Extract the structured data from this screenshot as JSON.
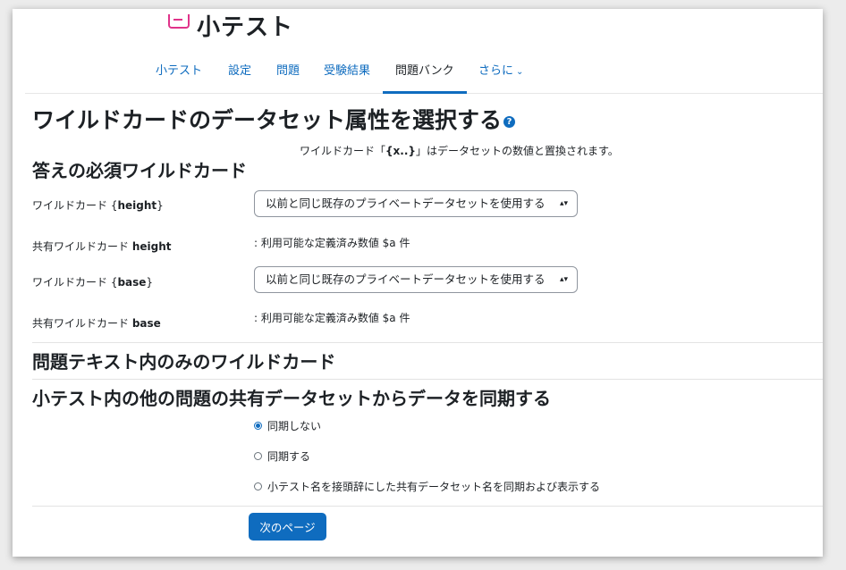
{
  "header": {
    "title": "小テスト"
  },
  "nav": {
    "tabs": [
      {
        "label": "小テスト"
      },
      {
        "label": "設定"
      },
      {
        "label": "問題"
      },
      {
        "label": "受験結果"
      },
      {
        "label": "問題バンク"
      },
      {
        "label": "さらに"
      }
    ],
    "active_tab": "問題バンク"
  },
  "page": {
    "heading": "ワイルドカードのデータセット属性を選択する",
    "note_prefix": "ワイルドカード「",
    "note_token": "{x..}",
    "note_suffix": "」はデータセットの数値と置換されます。"
  },
  "required_section": {
    "title": "答えの必須ワイルドカード",
    "rows": [
      {
        "label_prefix": "ワイルドカード {",
        "label_bold": "height",
        "label_suffix": "}",
        "select_value": "以前と同じ既存のプライベートデータセットを使用する"
      },
      {
        "label_prefix": "共有ワイルドカード ",
        "label_bold": "height",
        "value": ": 利用可能な定義済み数値 $a 件"
      },
      {
        "label_prefix": "ワイルドカード {",
        "label_bold": "base",
        "label_suffix": "}",
        "select_value": "以前と同じ既存のプライベートデータセットを使用する"
      },
      {
        "label_prefix": "共有ワイルドカード ",
        "label_bold": "base",
        "value": ": 利用可能な定義済み数値 $a 件"
      }
    ]
  },
  "text_only_section": {
    "title": "問題テキスト内のみのワイルドカード"
  },
  "sync_section": {
    "title": "小テスト内の他の問題の共有データセットからデータを同期する",
    "options": [
      {
        "label": "同期しない",
        "checked": true
      },
      {
        "label": "同期する",
        "checked": false
      },
      {
        "label": "小テスト名を接頭辞にした共有データセット名を同期および表示する",
        "checked": false
      }
    ]
  },
  "actions": {
    "next_label": "次のページ"
  },
  "colors": {
    "accent": "#0f6cbf",
    "quiz_icon": "#e0338a"
  }
}
